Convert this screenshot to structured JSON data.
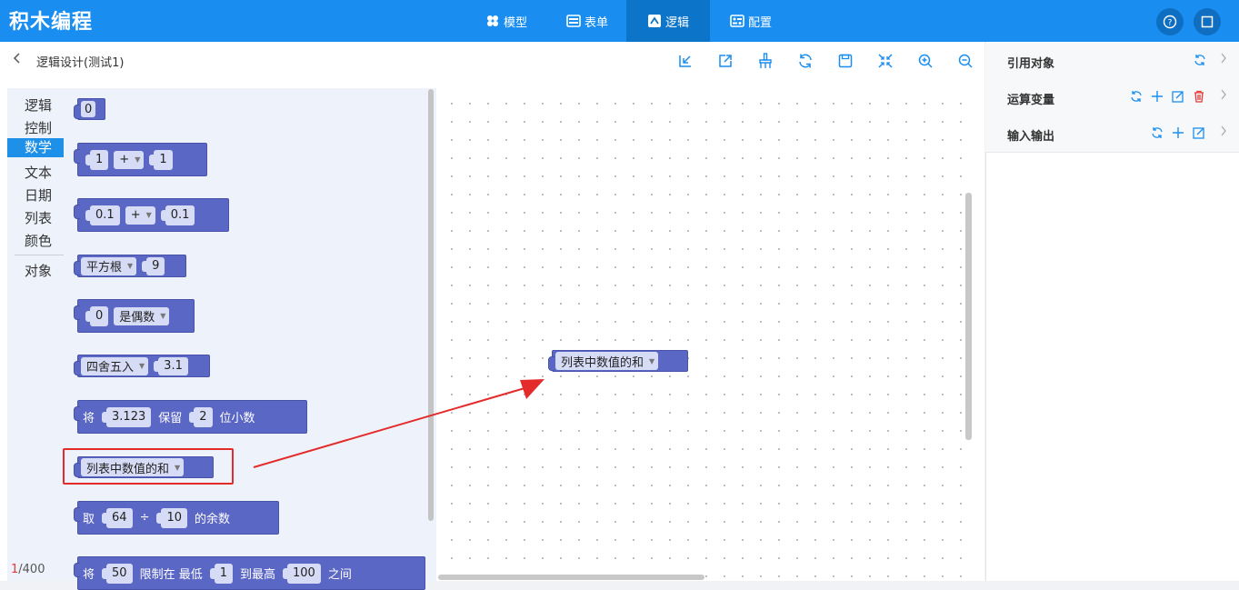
{
  "header": {
    "app_title": "积木编程",
    "tabs": [
      {
        "label": "模型",
        "icon": "model-icon"
      },
      {
        "label": "表单",
        "icon": "form-icon"
      },
      {
        "label": "逻辑",
        "icon": "logic-icon",
        "active": true
      },
      {
        "label": "配置",
        "icon": "config-icon"
      }
    ],
    "accent_color": "#1a8ef0"
  },
  "subheader": {
    "breadcrumb": "逻辑设计(测试1)",
    "toolbar_icons": [
      "import-icon",
      "export-icon",
      "clear-icon",
      "refresh-icon",
      "save-icon",
      "collapse-icon",
      "zoom-in-icon",
      "zoom-out-icon"
    ]
  },
  "categories": [
    {
      "label": "逻辑"
    },
    {
      "label": "控制"
    },
    {
      "label": "数学",
      "selected": true
    },
    {
      "label": "文本"
    },
    {
      "label": "日期"
    },
    {
      "label": "列表"
    },
    {
      "label": "颜色"
    },
    {
      "label": "对象"
    }
  ],
  "blocks": {
    "number": {
      "value": "0"
    },
    "arith_int": {
      "a": "1",
      "op": "+",
      "b": "1"
    },
    "arith_dec": {
      "a": "0.1",
      "op": "+",
      "b": "0.1"
    },
    "sqrt": {
      "fn": "平方根",
      "value": "9"
    },
    "even": {
      "value": "0",
      "test": "是偶数"
    },
    "round": {
      "fn": "四舍五入",
      "value": "3.1"
    },
    "fixed": {
      "prefix": "将",
      "value": "3.123",
      "mid": "保留",
      "digits": "2",
      "suffix": "位小数"
    },
    "list_sum": {
      "fn": "列表中数值的和"
    },
    "modulo": {
      "prefix": "取",
      "a": "64",
      "op": "÷",
      "b": "10",
      "suffix": "的余数"
    },
    "constrain": {
      "prefix": "将",
      "value": "50",
      "mid1": "限制在 最低",
      "low": "1",
      "mid2": "到最高",
      "high": "100",
      "suffix": "之间"
    }
  },
  "canvas_block": {
    "fn": "列表中数值的和"
  },
  "counter": {
    "current": "1",
    "total": "/400"
  },
  "right_panel": {
    "sections": [
      {
        "title": "引用对象"
      },
      {
        "title": "运算变量"
      },
      {
        "title": "输入输出"
      }
    ]
  }
}
